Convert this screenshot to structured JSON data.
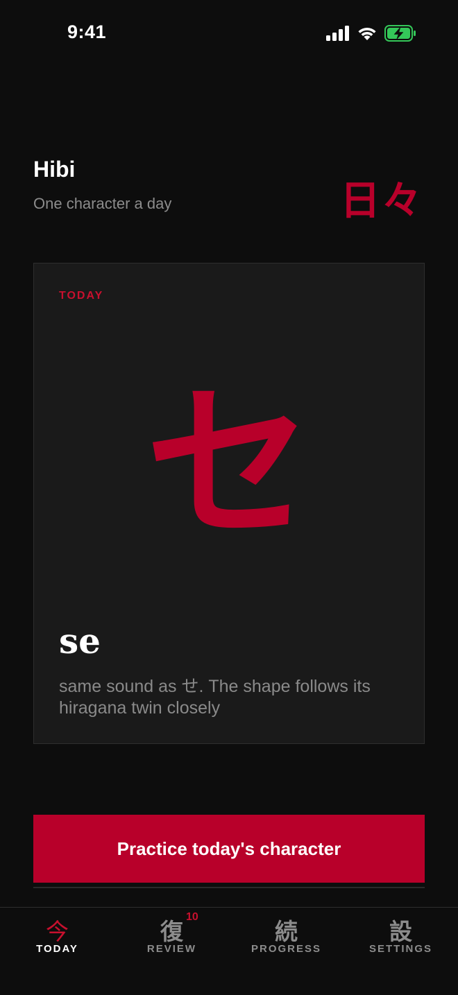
{
  "status_bar": {
    "time": "9:41"
  },
  "header": {
    "title": "Hibi",
    "subtitle": "One character a day",
    "brand_mark": "日々"
  },
  "card": {
    "label": "TODAY",
    "character": "セ",
    "romaji": "se",
    "note": "same sound as せ. The shape follows its hiragana twin closely"
  },
  "cta": {
    "label": "Practice today's character"
  },
  "tabs": [
    {
      "glyph": "今",
      "label": "TODAY",
      "active": true
    },
    {
      "glyph": "復",
      "label": "REVIEW",
      "badge": "10"
    },
    {
      "glyph": "続",
      "label": "PROGRESS"
    },
    {
      "glyph": "設",
      "label": "SETTINGS"
    }
  ],
  "colors": {
    "accent": "#b8002a",
    "background": "#0d0d0d",
    "card": "#1a1a1a",
    "muted_text": "#8c8c8c",
    "battery": "#34c759"
  },
  "icons": {
    "signal": "cellular-signal-icon",
    "wifi": "wifi-icon",
    "battery": "battery-charging-icon"
  }
}
